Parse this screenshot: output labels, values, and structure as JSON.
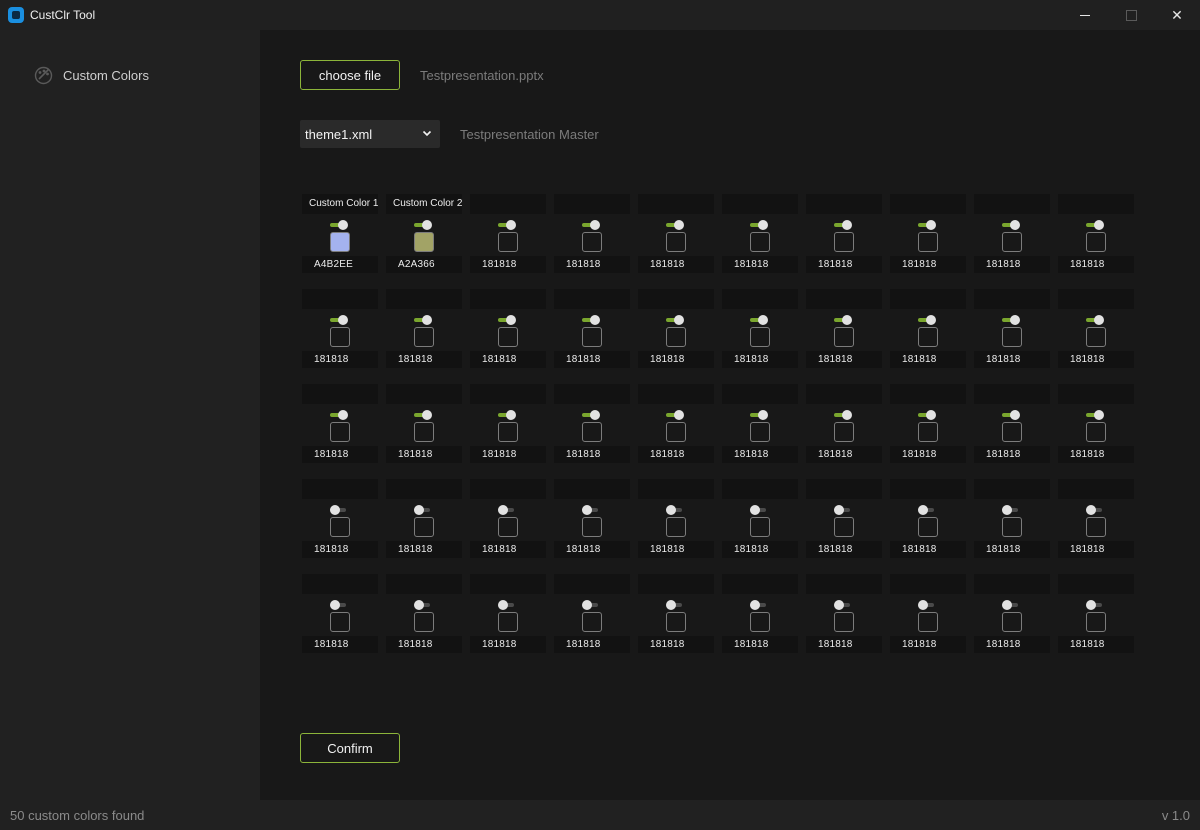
{
  "window": {
    "title": "CustClr Tool",
    "close_glyph": "✕"
  },
  "sidebar": {
    "items": [
      {
        "label": "Custom Colors",
        "icon": "palette-icon"
      }
    ]
  },
  "file": {
    "choose_label": "choose file",
    "file_name": "Testpresentation.pptx"
  },
  "theme": {
    "selected": "theme1.xml",
    "master_name": "Testpresentation Master"
  },
  "colors": {
    "accent": "#8cb43a",
    "toggle_on": "#7aa62e",
    "items": [
      {
        "name": "Custom Color 1",
        "hex": "A4B2EE",
        "enabled": true,
        "fill": "#A4B2EE"
      },
      {
        "name": "Custom Color 2",
        "hex": "A2A366",
        "enabled": true,
        "fill": "#A2A366"
      },
      {
        "name": "",
        "hex": "181818",
        "enabled": true,
        "fill": "#181818"
      },
      {
        "name": "",
        "hex": "181818",
        "enabled": true,
        "fill": "#181818"
      },
      {
        "name": "",
        "hex": "181818",
        "enabled": true,
        "fill": "#181818"
      },
      {
        "name": "",
        "hex": "181818",
        "enabled": true,
        "fill": "#181818"
      },
      {
        "name": "",
        "hex": "181818",
        "enabled": true,
        "fill": "#181818"
      },
      {
        "name": "",
        "hex": "181818",
        "enabled": true,
        "fill": "#181818"
      },
      {
        "name": "",
        "hex": "181818",
        "enabled": true,
        "fill": "#181818"
      },
      {
        "name": "",
        "hex": "181818",
        "enabled": true,
        "fill": "#181818"
      },
      {
        "name": "",
        "hex": "181818",
        "enabled": true,
        "fill": "#181818"
      },
      {
        "name": "",
        "hex": "181818",
        "enabled": true,
        "fill": "#181818"
      },
      {
        "name": "",
        "hex": "181818",
        "enabled": true,
        "fill": "#181818"
      },
      {
        "name": "",
        "hex": "181818",
        "enabled": true,
        "fill": "#181818"
      },
      {
        "name": "",
        "hex": "181818",
        "enabled": true,
        "fill": "#181818"
      },
      {
        "name": "",
        "hex": "181818",
        "enabled": true,
        "fill": "#181818"
      },
      {
        "name": "",
        "hex": "181818",
        "enabled": true,
        "fill": "#181818"
      },
      {
        "name": "",
        "hex": "181818",
        "enabled": true,
        "fill": "#181818"
      },
      {
        "name": "",
        "hex": "181818",
        "enabled": true,
        "fill": "#181818"
      },
      {
        "name": "",
        "hex": "181818",
        "enabled": true,
        "fill": "#181818"
      },
      {
        "name": "",
        "hex": "181818",
        "enabled": true,
        "fill": "#181818"
      },
      {
        "name": "",
        "hex": "181818",
        "enabled": true,
        "fill": "#181818"
      },
      {
        "name": "",
        "hex": "181818",
        "enabled": true,
        "fill": "#181818"
      },
      {
        "name": "",
        "hex": "181818",
        "enabled": true,
        "fill": "#181818"
      },
      {
        "name": "",
        "hex": "181818",
        "enabled": true,
        "fill": "#181818"
      },
      {
        "name": "",
        "hex": "181818",
        "enabled": true,
        "fill": "#181818"
      },
      {
        "name": "",
        "hex": "181818",
        "enabled": true,
        "fill": "#181818"
      },
      {
        "name": "",
        "hex": "181818",
        "enabled": true,
        "fill": "#181818"
      },
      {
        "name": "",
        "hex": "181818",
        "enabled": true,
        "fill": "#181818"
      },
      {
        "name": "",
        "hex": "181818",
        "enabled": true,
        "fill": "#181818"
      },
      {
        "name": "",
        "hex": "181818",
        "enabled": false,
        "fill": "#181818"
      },
      {
        "name": "",
        "hex": "181818",
        "enabled": false,
        "fill": "#181818"
      },
      {
        "name": "",
        "hex": "181818",
        "enabled": false,
        "fill": "#181818"
      },
      {
        "name": "",
        "hex": "181818",
        "enabled": false,
        "fill": "#181818"
      },
      {
        "name": "",
        "hex": "181818",
        "enabled": false,
        "fill": "#181818"
      },
      {
        "name": "",
        "hex": "181818",
        "enabled": false,
        "fill": "#181818"
      },
      {
        "name": "",
        "hex": "181818",
        "enabled": false,
        "fill": "#181818"
      },
      {
        "name": "",
        "hex": "181818",
        "enabled": false,
        "fill": "#181818"
      },
      {
        "name": "",
        "hex": "181818",
        "enabled": false,
        "fill": "#181818"
      },
      {
        "name": "",
        "hex": "181818",
        "enabled": false,
        "fill": "#181818"
      },
      {
        "name": "",
        "hex": "181818",
        "enabled": false,
        "fill": "#181818"
      },
      {
        "name": "",
        "hex": "181818",
        "enabled": false,
        "fill": "#181818"
      },
      {
        "name": "",
        "hex": "181818",
        "enabled": false,
        "fill": "#181818"
      },
      {
        "name": "",
        "hex": "181818",
        "enabled": false,
        "fill": "#181818"
      },
      {
        "name": "",
        "hex": "181818",
        "enabled": false,
        "fill": "#181818"
      },
      {
        "name": "",
        "hex": "181818",
        "enabled": false,
        "fill": "#181818"
      },
      {
        "name": "",
        "hex": "181818",
        "enabled": false,
        "fill": "#181818"
      },
      {
        "name": "",
        "hex": "181818",
        "enabled": false,
        "fill": "#181818"
      },
      {
        "name": "",
        "hex": "181818",
        "enabled": false,
        "fill": "#181818"
      },
      {
        "name": "",
        "hex": "181818",
        "enabled": false,
        "fill": "#181818"
      }
    ]
  },
  "actions": {
    "confirm_label": "Confirm"
  },
  "status": {
    "text": "50 custom colors found",
    "version": "v 1.0"
  }
}
